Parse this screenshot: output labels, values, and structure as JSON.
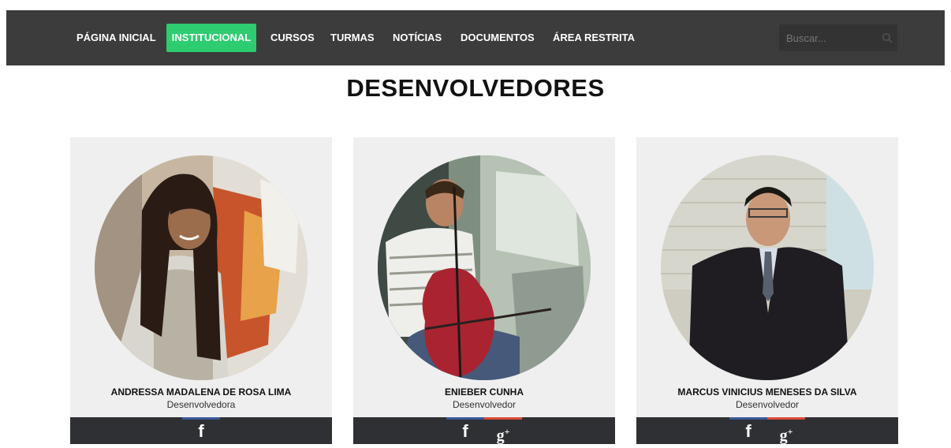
{
  "nav": {
    "items": [
      {
        "label": "PÁGINA INICIAL",
        "active": false
      },
      {
        "label": "INSTITUCIONAL",
        "active": true
      },
      {
        "label": "CURSOS",
        "active": false
      },
      {
        "label": "TURMAS",
        "active": false
      },
      {
        "label": "NOTÍCIAS",
        "active": false
      },
      {
        "label": "DOCUMENTOS",
        "active": false
      },
      {
        "label": "ÁREA RESTRITA",
        "active": false
      }
    ],
    "search": {
      "placeholder": "Buscar...",
      "value": ""
    }
  },
  "page": {
    "title": "DESENVOLVEDORES"
  },
  "developers": [
    {
      "name": "ANDRESSA MADALENA DE ROSA LIMA",
      "role": "Desenvolvedora",
      "social": [
        "facebook-icon"
      ]
    },
    {
      "name": "ENIEBER CUNHA",
      "role": "Desenvolvedor",
      "social": [
        "facebook-icon",
        "google-plus-icon"
      ]
    },
    {
      "name": "MARCUS VINICIUS MENESES DA SILVA",
      "role": "Desenvolvedor",
      "social": [
        "facebook-icon",
        "google-plus-icon"
      ]
    }
  ],
  "colors": {
    "navbar_bg": "#3c3c3c",
    "active_nav": "#2ecc71",
    "card_bg": "#efefef",
    "social_bar_bg": "#2e3033",
    "facebook_accent": "#3b5998",
    "google_plus_accent": "#dd4b39"
  }
}
